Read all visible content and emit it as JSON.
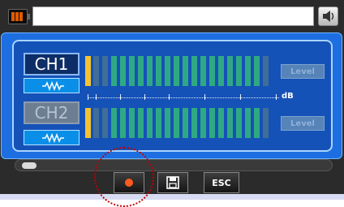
{
  "title": "",
  "channels": [
    {
      "label": "CH1",
      "level_button": "Level",
      "active": true,
      "meter_level": 0.05
    },
    {
      "label": "CH2",
      "level_button": "Level",
      "active": false,
      "meter_level": 0.05
    }
  ],
  "scale_unit": "dB",
  "toolbar": {
    "esc_label": "ESC"
  },
  "progress": 0.02,
  "colors": {
    "panel": "#1d6ee0",
    "record": "#ff5a1f",
    "meter_on": "#2fa983",
    "callout": "#c20000"
  }
}
